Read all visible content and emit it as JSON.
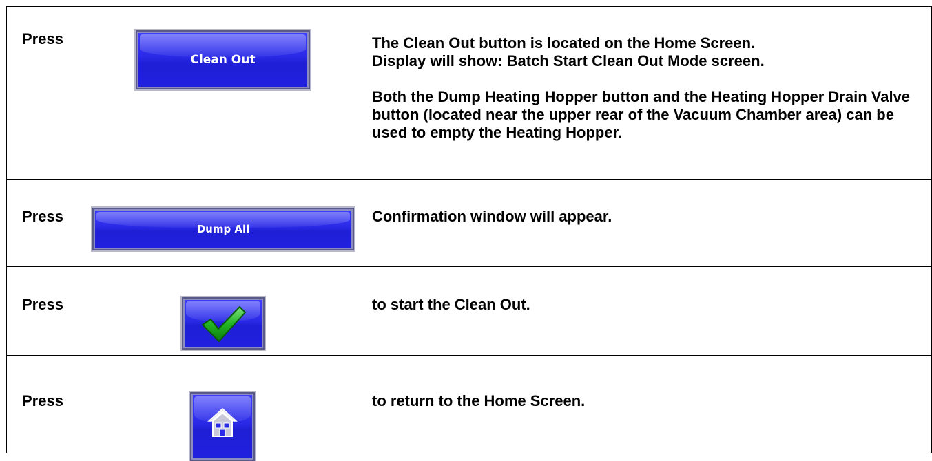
{
  "steps": [
    {
      "action": "Press",
      "button_label": "Clean Out",
      "description": [
        "The Clean Out button is located on the Home Screen.\nDisplay will show: Batch Start Clean Out Mode screen.",
        "Both the Dump Heating Hopper button and the Heating Hopper Drain Valve button (located near the upper rear of the Vacuum Chamber area) can be used to empty the Heating Hopper."
      ]
    },
    {
      "action": "Press",
      "button_label": "Dump All",
      "description": [
        "Confirmation window will appear."
      ]
    },
    {
      "action": "Press",
      "button_icon": "checkmark-icon",
      "description": [
        "to start the Clean Out."
      ]
    },
    {
      "action": "Press",
      "button_icon": "home-icon",
      "description": [
        "to return to the Home Screen."
      ]
    }
  ],
  "colors": {
    "button_blue": "#2a2ae6",
    "check_green": "#22b422",
    "border": "#000000"
  }
}
